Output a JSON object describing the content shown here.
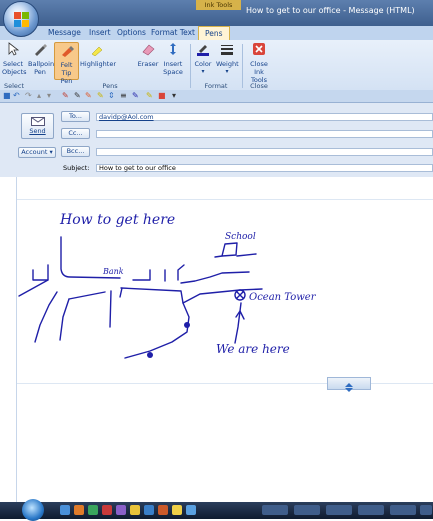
{
  "window": {
    "title": "How to get to our office  - Message (HTML)",
    "contextual_tab_group": "Ink Tools"
  },
  "tabs": [
    {
      "label": "Message"
    },
    {
      "label": "Insert"
    },
    {
      "label": "Options"
    },
    {
      "label": "Format Text"
    },
    {
      "label": "Pens",
      "active": true
    }
  ],
  "ribbon": {
    "buttons": [
      {
        "label": "Select",
        "label2": "Objects",
        "icon": "arrow-cursor-icon"
      },
      {
        "label": "Ballpoint",
        "label2": "Pen",
        "icon": "ballpoint-pen-icon"
      },
      {
        "label": "Felt Tip",
        "label2": "Pen",
        "icon": "felt-tip-pen-icon",
        "selected": true
      },
      {
        "label": "Highlighter",
        "label2": "",
        "icon": "highlighter-icon"
      },
      {
        "label": "Eraser",
        "label2": "",
        "icon": "eraser-icon"
      },
      {
        "label": "Insert",
        "label2": "Space",
        "icon": "insert-space-icon"
      },
      {
        "label": "Color",
        "label2": "",
        "icon": "pen-color-icon"
      },
      {
        "label": "Weight",
        "label2": "",
        "icon": "pen-weight-icon"
      },
      {
        "label": "Close Ink",
        "label2": "Tools",
        "icon": "close-ink-icon"
      }
    ],
    "groups": [
      "Select",
      "Pens",
      "Format",
      "Close"
    ]
  },
  "header": {
    "send_label": "Send",
    "account_label": "Account",
    "to_label": "To...",
    "cc_label": "Cc...",
    "bcc_label": "Bcc...",
    "subject_label": "Subject:",
    "to_value": "davidp@Aol.com",
    "cc_value": "",
    "bcc_value": "",
    "subject_value": "How to get to our office"
  },
  "ink": {
    "heading": "How to get here",
    "label_school": "School",
    "label_bank": "Bank",
    "label_tower": "Ocean Tower",
    "label_here": "We are here"
  },
  "colors": {
    "ink": "#1f1fa8",
    "accent": "#f8c98a",
    "ribbon": "#dbe6f4"
  }
}
